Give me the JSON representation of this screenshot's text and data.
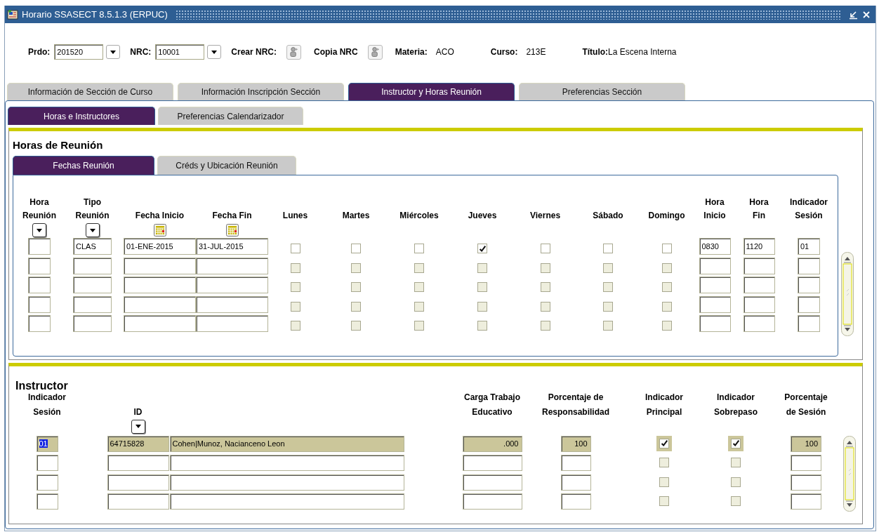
{
  "window": {
    "title": "Horario SSASECT 8.5.1.3 (ERPUC)"
  },
  "header": [
    {
      "kind": "field",
      "label": "Prdo:",
      "value": "201520",
      "dropdown": true
    },
    {
      "kind": "field",
      "label": "NRC:",
      "value": "10001",
      "dropdown": true
    },
    {
      "kind": "action",
      "label": "Crear NRC:"
    },
    {
      "kind": "action",
      "label": "Copia NRC"
    },
    {
      "kind": "info",
      "label": "Materia:",
      "value": "ACO"
    },
    {
      "kind": "info",
      "label": "Curso:",
      "value": "213E"
    },
    {
      "kind": "info",
      "label": "Título:",
      "value": "La Escena Interna"
    }
  ],
  "tabs": [
    {
      "label": "Información de Sección de Curso",
      "selected": false
    },
    {
      "label": "Información Inscripción Sección",
      "selected": false
    },
    {
      "label": "Instructor y Horas Reunión",
      "selected": true
    },
    {
      "label": "Preferencias Sección",
      "selected": false
    }
  ],
  "subtabs": [
    {
      "label": "Horas e Instructores",
      "selected": true
    },
    {
      "label": "Preferencias Calendarizador",
      "selected": false
    }
  ],
  "meeting": {
    "title": "Horas de Reunión",
    "tabs": [
      {
        "label": "Fechas Reunión",
        "selected": true
      },
      {
        "label": "Créds y Ubicación Reunión",
        "selected": false
      }
    ],
    "columns": [
      {
        "kind": "field",
        "lines": [
          "Hora",
          "Reunión"
        ],
        "dropdown": true
      },
      {
        "kind": "field",
        "lines": [
          "Tipo",
          "Reunión"
        ],
        "dropdown": true
      },
      {
        "kind": "field",
        "lines": [
          "Fecha Inicio"
        ],
        "calendar": true
      },
      {
        "kind": "field",
        "lines": [
          "Fecha Fin"
        ],
        "calendar": true
      },
      {
        "kind": "check",
        "lines": [
          "Lunes"
        ]
      },
      {
        "kind": "check",
        "lines": [
          "Martes"
        ]
      },
      {
        "kind": "check",
        "lines": [
          "Miércoles"
        ]
      },
      {
        "kind": "check",
        "lines": [
          "Jueves"
        ]
      },
      {
        "kind": "check",
        "lines": [
          "Viernes"
        ]
      },
      {
        "kind": "check",
        "lines": [
          "Sábado"
        ]
      },
      {
        "kind": "check",
        "lines": [
          "Domingo"
        ]
      },
      {
        "kind": "field",
        "lines": [
          "Hora",
          "Inicio"
        ]
      },
      {
        "kind": "field",
        "lines": [
          "Hora",
          "Fin"
        ]
      },
      {
        "kind": "field",
        "lines": [
          "Indicador",
          "Sesión"
        ]
      }
    ],
    "rows": [
      {
        "disabled": false,
        "tipo_reunion": "CLAS",
        "fecha_inicio": "01-ENE-2015",
        "fecha_fin": "31-JUL-2015",
        "lunes": false,
        "martes": false,
        "miercoles": false,
        "jueves": true,
        "viernes": false,
        "sabado": false,
        "domingo": false,
        "hora_inicio": "0830",
        "hora_fin": "1120",
        "indicador_sesion": "01"
      },
      {
        "disabled": true,
        "lunes": false,
        "martes": false,
        "miercoles": false,
        "jueves": false,
        "viernes": false,
        "sabado": false,
        "domingo": false
      },
      {
        "disabled": true,
        "lunes": false,
        "martes": false,
        "miercoles": false,
        "jueves": false,
        "viernes": false,
        "sabado": false,
        "domingo": false
      },
      {
        "disabled": true,
        "lunes": false,
        "martes": false,
        "miercoles": false,
        "jueves": false,
        "viernes": false,
        "sabado": false,
        "domingo": false
      },
      {
        "disabled": true,
        "lunes": false,
        "martes": false,
        "miercoles": false,
        "jueves": false,
        "viernes": false,
        "sabado": false,
        "domingo": false
      }
    ]
  },
  "instructor": {
    "title": "Instructor",
    "columns": [
      {
        "kind": "field",
        "lines": [
          "Indicador",
          "Sesión"
        ]
      },
      {
        "kind": "field",
        "lines": [
          "ID"
        ],
        "dropdown": true
      },
      {
        "kind": "field"
      },
      {
        "kind": "field",
        "lines": [
          "Carga Trabajo",
          "Educativo"
        ]
      },
      {
        "kind": "field",
        "lines": [
          "Porcentaje de",
          "Responsabilidad"
        ]
      },
      {
        "kind": "check",
        "lines": [
          "Indicador",
          "Principal"
        ]
      },
      {
        "kind": "check",
        "lines": [
          "Indicador",
          "Sobrepaso"
        ]
      },
      {
        "kind": "field",
        "lines": [
          "Porcentaje",
          "de Sesión"
        ]
      }
    ],
    "rows": [
      {
        "selected": true,
        "disabled": false,
        "indicador_sesion": "01",
        "id": "64715828",
        "column_3": "Cohen|Munoz, Nacianceno Leon",
        "carga_trabajo": ".000",
        "porcentaje_responsabilidad": "100",
        "indicador_principal": true,
        "indicador_sobrepaso": true,
        "porcentaje_sesion": "100"
      },
      {
        "selected": false,
        "disabled": true,
        "indicador_principal": false,
        "indicador_sobrepaso": false
      },
      {
        "selected": false,
        "disabled": true,
        "indicador_principal": false,
        "indicador_sobrepaso": false
      },
      {
        "selected": false,
        "disabled": true,
        "indicador_principal": false,
        "indicador_sobrepaso": false
      }
    ]
  }
}
